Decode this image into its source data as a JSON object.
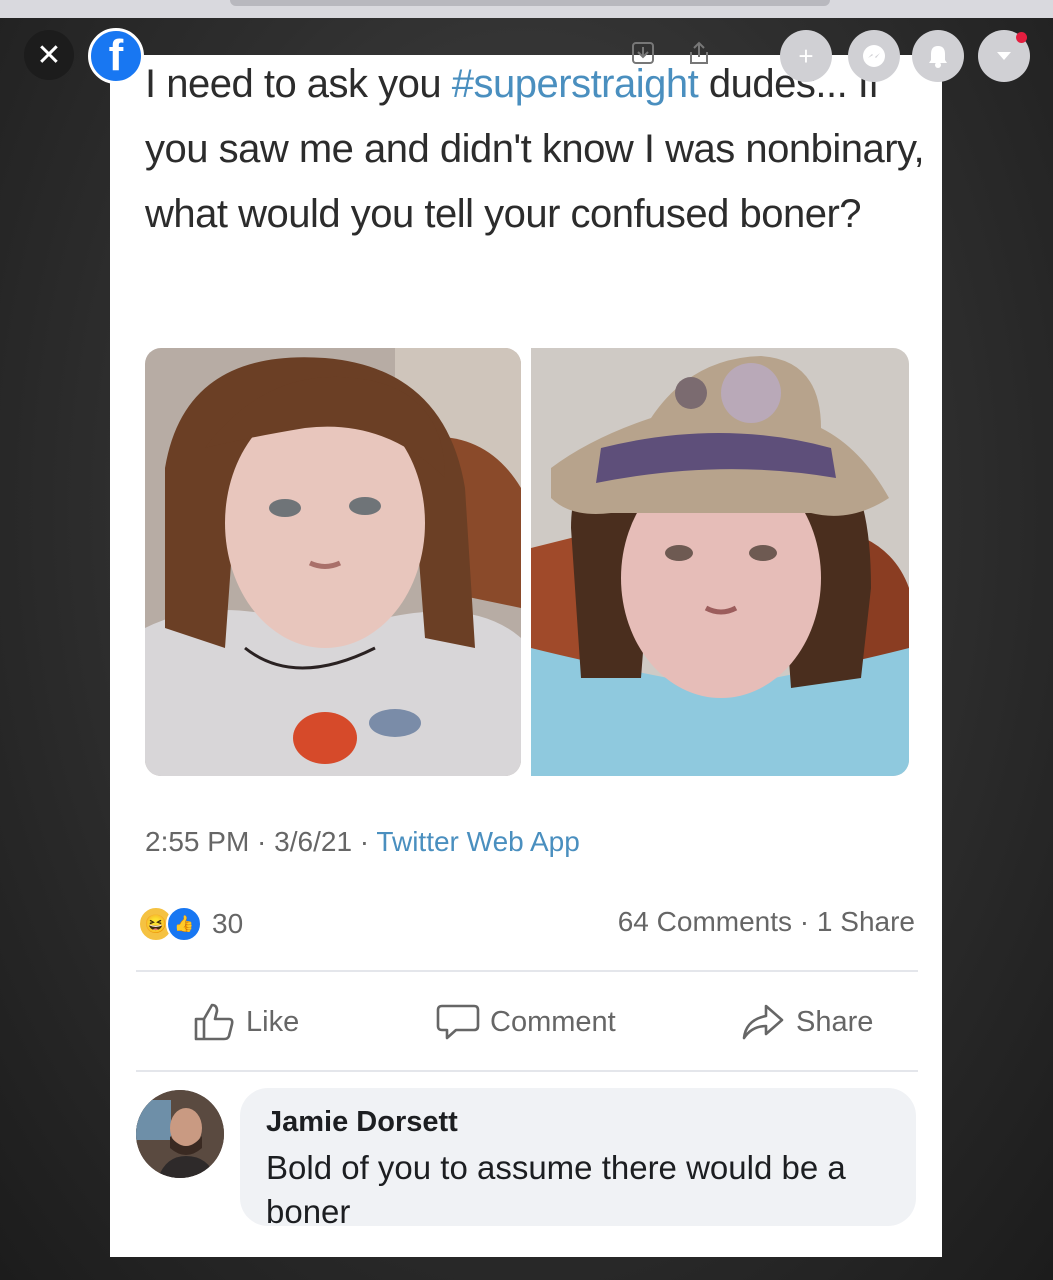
{
  "post": {
    "text_before_hashtag": "I need to ask you ",
    "hashtag": "#superstraight",
    "text_after_hashtag": " dudes... If you saw me and didn't know I was nonbinary, what would you tell your confused boner?",
    "time": "2:55 PM",
    "date": "3/6/21",
    "source": "Twitter Web App"
  },
  "reactions": {
    "icons": [
      "haha-icon",
      "like-icon"
    ],
    "count": "30",
    "comments_label": "64 Comments",
    "shares_label": "1 Share"
  },
  "actions": {
    "like": "Like",
    "comment": "Comment",
    "share": "Share"
  },
  "comment": {
    "author": "Jamie Dorsett",
    "text": "Bold of you to assume there would be a boner"
  },
  "colors": {
    "facebook_blue": "#1877f2",
    "hashtag_link": "#4a8fbf",
    "notification_dot": "#e41e3f"
  }
}
